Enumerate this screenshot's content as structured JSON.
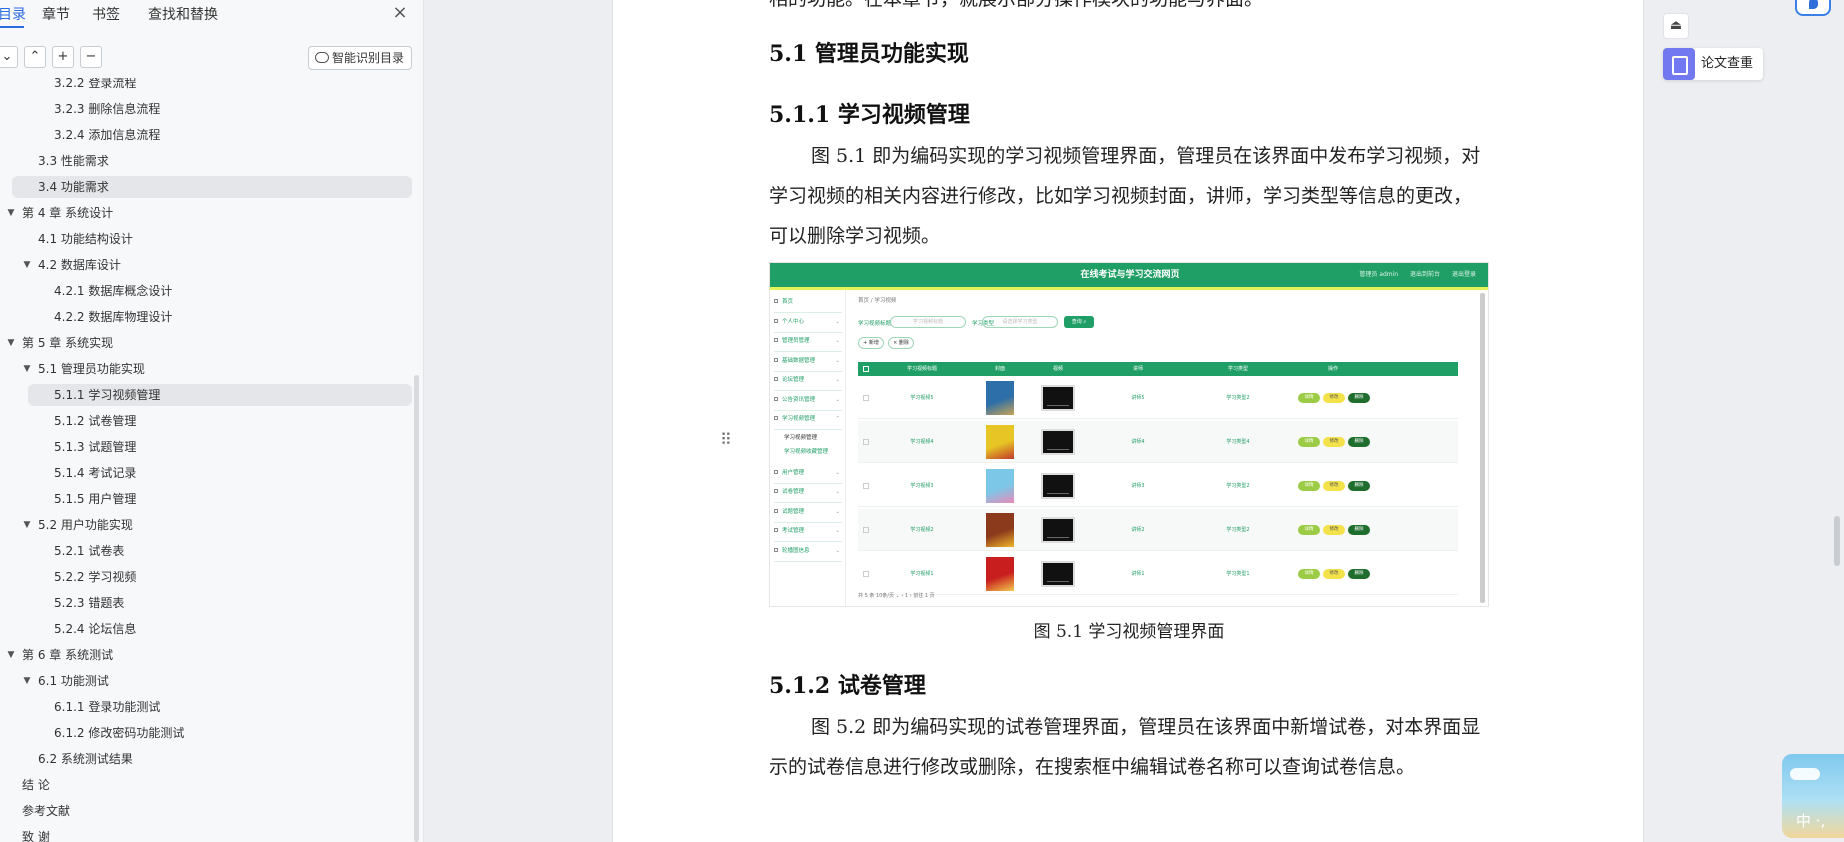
{
  "nav": {
    "tabs": [
      "目录",
      "章节",
      "书签",
      "查找和替换"
    ],
    "close_icon": "×",
    "tools": [
      "⌄",
      "⌃",
      "+",
      "−"
    ],
    "smart_toc_label": "智能识别目录",
    "toc": [
      {
        "label": "3.2.2  登录流程",
        "level": 3,
        "arrow": ""
      },
      {
        "label": "3.2.3  删除信息流程",
        "level": 3,
        "arrow": ""
      },
      {
        "label": "3.2.4  添加信息流程",
        "level": 3,
        "arrow": ""
      },
      {
        "label": "3.3  性能需求",
        "level": 2,
        "arrow": ""
      },
      {
        "label": "3.4  功能需求",
        "level": 2,
        "arrow": "",
        "highlight": true
      },
      {
        "label": "第 4 章  系统设计",
        "level": 1,
        "arrow": "▼"
      },
      {
        "label": "4.1  功能结构设计",
        "level": 2,
        "arrow": ""
      },
      {
        "label": "4.2  数据库设计",
        "level": 2,
        "arrow": "▼"
      },
      {
        "label": "4.2.1  数据库概念设计",
        "level": 3,
        "arrow": ""
      },
      {
        "label": "4.2.2  数据库物理设计",
        "level": 3,
        "arrow": ""
      },
      {
        "label": "第 5 章  系统实现",
        "level": 1,
        "arrow": "▼"
      },
      {
        "label": "5.1  管理员功能实现",
        "level": 2,
        "arrow": "▼"
      },
      {
        "label": "5.1.1  学习视频管理",
        "level": 3,
        "arrow": "",
        "highlight": true
      },
      {
        "label": "5.1.2  试卷管理",
        "level": 3,
        "arrow": ""
      },
      {
        "label": "5.1.3  试题管理",
        "level": 3,
        "arrow": ""
      },
      {
        "label": "5.1.4  考试记录",
        "level": 3,
        "arrow": ""
      },
      {
        "label": "5.1.5  用户管理",
        "level": 3,
        "arrow": ""
      },
      {
        "label": "5.2  用户功能实现",
        "level": 2,
        "arrow": "▼"
      },
      {
        "label": "5.2.1  试卷表",
        "level": 3,
        "arrow": ""
      },
      {
        "label": "5.2.2  学习视频",
        "level": 3,
        "arrow": ""
      },
      {
        "label": "5.2.3  错题表",
        "level": 3,
        "arrow": ""
      },
      {
        "label": "5.2.4  论坛信息",
        "level": 3,
        "arrow": ""
      },
      {
        "label": "第 6 章  系统测试",
        "level": 1,
        "arrow": "▼"
      },
      {
        "label": "6.1  功能测试",
        "level": 2,
        "arrow": "▼"
      },
      {
        "label": "6.1.1  登录功能测试",
        "level": 3,
        "arrow": ""
      },
      {
        "label": "6.1.2  修改密码功能测试",
        "level": 3,
        "arrow": ""
      },
      {
        "label": "6.2  系统测试结果",
        "level": 2,
        "arrow": ""
      },
      {
        "label": "结    论",
        "level": 1,
        "arrow": ""
      },
      {
        "label": "参考文献",
        "level": 1,
        "arrow": ""
      },
      {
        "label": "致    谢",
        "level": 1,
        "arrow": ""
      }
    ]
  },
  "doc": {
    "top_cut_text": "相的功能。在本章节，就展示部分操作模块的功能与界面。",
    "h2": "5.1  管理员功能实现",
    "h3_1": "5.1.1  学习视频管理",
    "para_1": "图 5.1  即为编码实现的学习视频管理界面，管理员在该界面中发布学习视频，对学习视频的相关内容进行修改，比如学习视频封面，讲师，学习类型等信息的更改，可以删除学习视频。",
    "caption_1": "图 5.1  学习视频管理界面",
    "h3_2": "5.1.2  试卷管理",
    "para_2": "图 5.2  即为编码实现的试卷管理界面，管理员在该界面中新增试卷，对本界面显示的试卷信息进行修改或删除，在搜索框中编辑试卷名称可以查询试卷信息。",
    "drag_icon": "⠿"
  },
  "figure": {
    "title": "在线考试与学习交流网页",
    "top_links": [
      "管理员 admin",
      "退出到前台",
      "退出登录"
    ],
    "menu": [
      {
        "label": "首页",
        "chev": ""
      },
      {
        "label": "个人中心",
        "chev": "⌄"
      },
      {
        "label": "管理员管理",
        "chev": "⌄"
      },
      {
        "label": "基础数据管理",
        "chev": "⌄"
      },
      {
        "label": "论坛管理",
        "chev": "⌄"
      },
      {
        "label": "公告资讯管理",
        "chev": "⌄"
      },
      {
        "label": "学习视频管理",
        "chev": "⌃"
      }
    ],
    "submenu": [
      "学习视频管理",
      "学习视频收藏管理"
    ],
    "menu_after": [
      {
        "label": "用户管理",
        "chev": "⌄"
      },
      {
        "label": "试卷管理",
        "chev": "⌄"
      },
      {
        "label": "试题管理",
        "chev": "⌄"
      },
      {
        "label": "考试管理",
        "chev": "⌄"
      },
      {
        "label": "轮播图信息",
        "chev": "⌄"
      }
    ],
    "breadcrumb": "首页  /  学习视频",
    "search_label_1": "学习视频标题",
    "search_placeholder_1": "学习视频标题",
    "search_label_2": "学习类型",
    "search_placeholder_2": "请选择学习类型",
    "search_button": "查询 ⌕",
    "add_button": "+ 新增",
    "delete_button": "× 删除",
    "columns": [
      "学习视频标题",
      "封面",
      "视频",
      "讲师",
      "学习类型",
      "操作"
    ],
    "rows": [
      {
        "title": "学习视频5",
        "lecturer": "讲师5",
        "type": "学习类型2",
        "cover_color": "#2d6fa8",
        "cover_accent": "#c9a456"
      },
      {
        "title": "学习视频4",
        "lecturer": "讲师4",
        "type": "学习类型4",
        "cover_color": "#e7c525",
        "cover_accent": "#c0392b"
      },
      {
        "title": "学习视频3",
        "lecturer": "讲师3",
        "type": "学习类型2",
        "cover_color": "#7cc7e8",
        "cover_accent": "#e88ab7"
      },
      {
        "title": "学习视频2",
        "lecturer": "讲师2",
        "type": "学习类型2",
        "cover_color": "#8c3a1c",
        "cover_accent": "#f0b429"
      },
      {
        "title": "学习视频1",
        "lecturer": "讲师1",
        "type": "学习类型1",
        "cover_color": "#c81e1e",
        "cover_accent": "#f2c94c"
      }
    ],
    "op_view": "详情",
    "op_edit": "修改",
    "op_del": "删除",
    "pager": "共 5 条    10条/页  ⌄    ‹   1   ›    前往   1   页"
  },
  "right": {
    "collapse_icon": "⏏",
    "check_label": "论文查重",
    "ime_label": "中 ·,"
  }
}
